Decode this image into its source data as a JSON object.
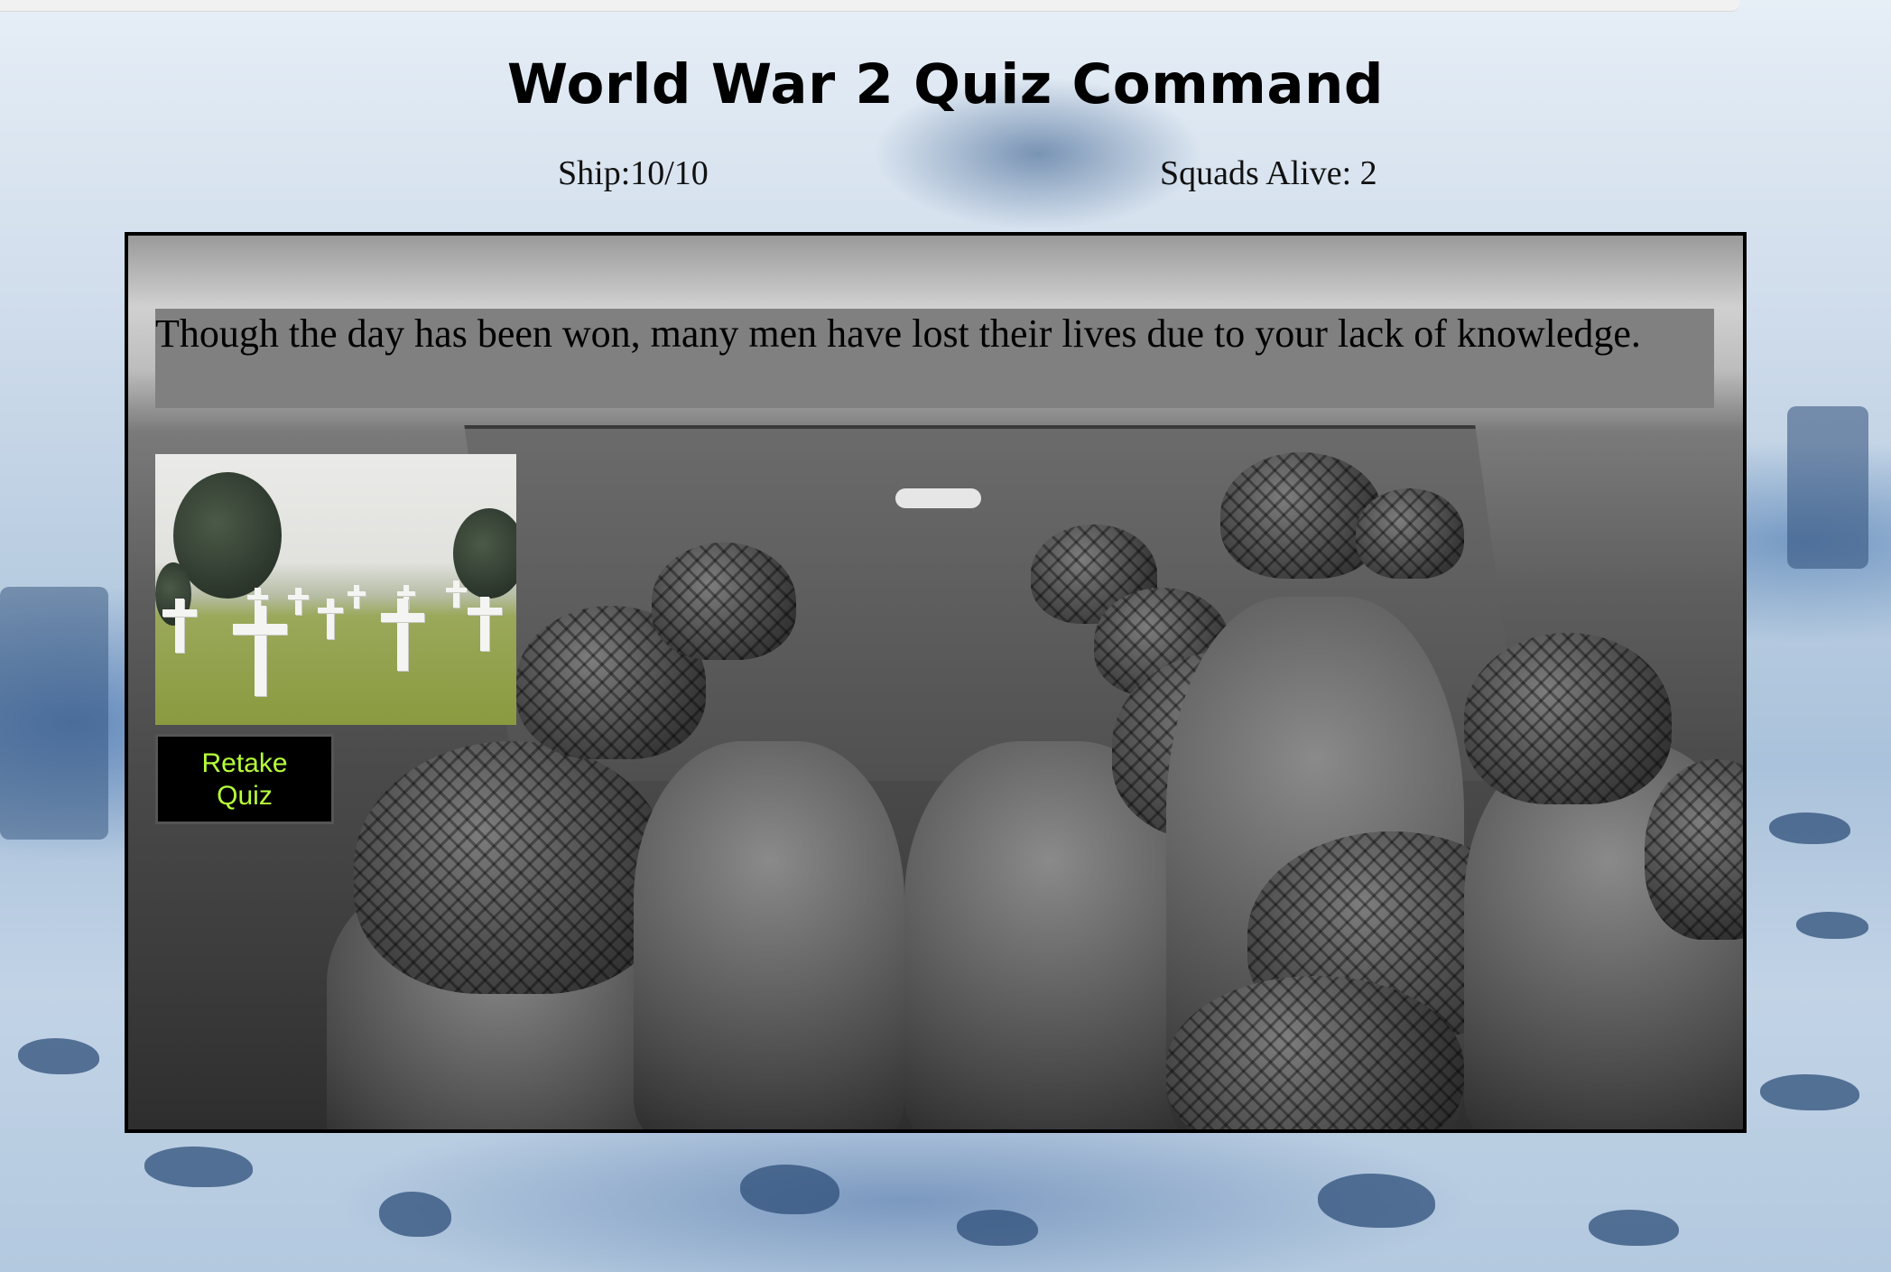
{
  "header": {
    "title": "World War 2 Quiz Command"
  },
  "stats": {
    "ship": "Ship:10/10",
    "squads": "Squads Alive: 2"
  },
  "result": {
    "message": "Though the day has been won, many men have lost their lives due to your lack of knowledge.",
    "image_alt": "cemetery-image"
  },
  "actions": {
    "retake_label": "Retake\nQuiz"
  },
  "colors": {
    "retake_text": "#b8ff3a",
    "message_bg": "#808080",
    "frame_border": "#000000"
  }
}
